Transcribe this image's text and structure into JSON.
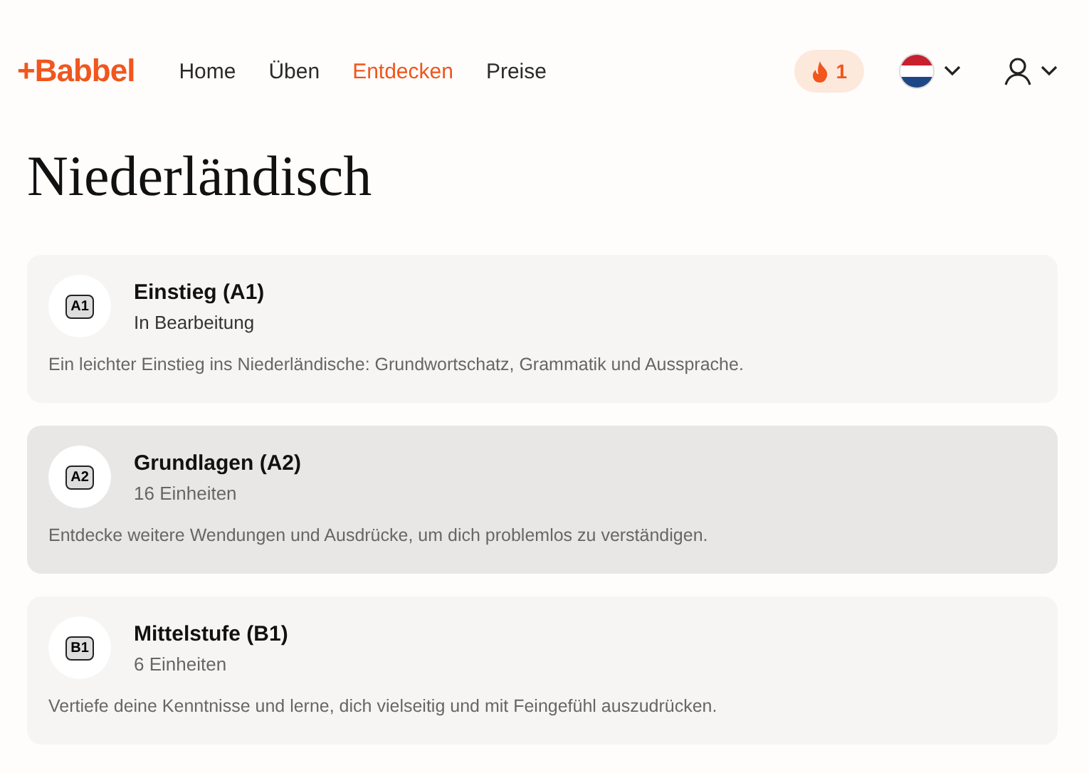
{
  "header": {
    "logo": "+Babbel",
    "nav": [
      {
        "label": "Home",
        "selected": false
      },
      {
        "label": "Üben",
        "selected": false
      },
      {
        "label": "Entdecken",
        "selected": true
      },
      {
        "label": "Preise",
        "selected": false
      }
    ],
    "streak": "1"
  },
  "title": "Niederländisch",
  "levels": [
    {
      "badge": "A1",
      "name": "Einstieg (A1)",
      "status": "In Bearbeitung",
      "description": "Ein leichter Einstieg ins Niederländische: Grundwortschatz, Grammatik und Aussprache.",
      "selected": false
    },
    {
      "badge": "A2",
      "name": "Grundlagen (A2)",
      "status": "16 Einheiten",
      "description": "Entdecke weitere Wendungen und Ausdrücke, um dich problemlos zu verständigen.",
      "selected": true
    },
    {
      "badge": "B1",
      "name": "Mittelstufe (B1)",
      "status": "6 Einheiten",
      "description": "Vertiefe deine Kenntnisse und lerne, dich vielseitig und mit Feingefühl auszudrücken.",
      "selected": false
    }
  ]
}
